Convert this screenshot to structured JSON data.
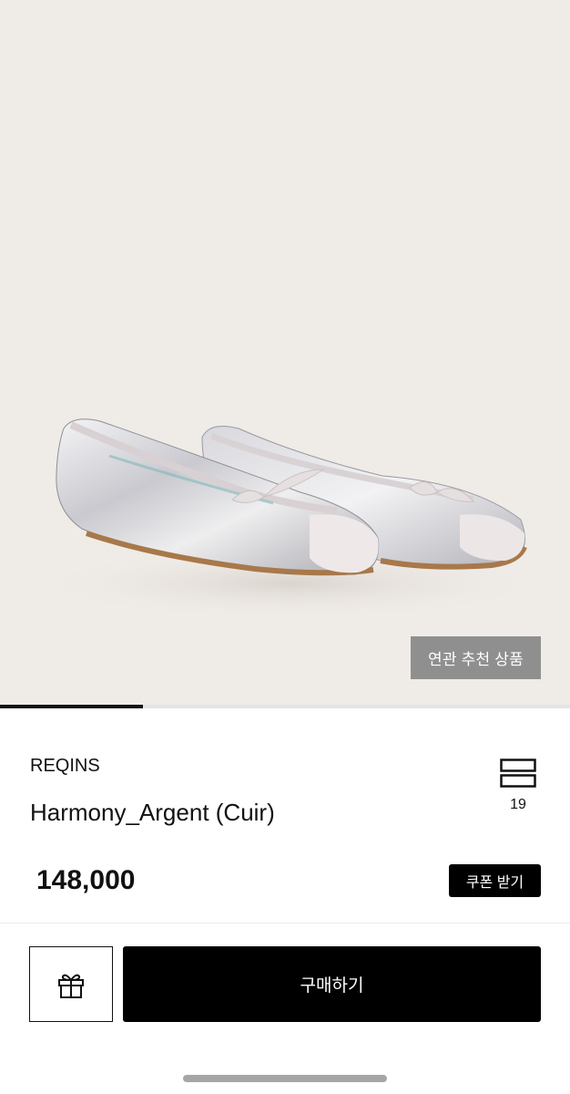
{
  "hero": {
    "image_alt": "silver leather ballet flats with pale pink toe caps and bows",
    "related_button_label": "연관 추천 상품",
    "carousel_progress": 0.25
  },
  "product": {
    "brand": "REQINS",
    "name": "Harmony_Argent (Cuir)",
    "price": "148,000",
    "like_count": "19",
    "like_icon": "stacked-bars-icon"
  },
  "actions": {
    "coupon_label": "쿠폰 받기",
    "gift_icon": "gift-icon",
    "buy_label": "구매하기"
  },
  "colors": {
    "background": "#efebe7",
    "accent": "#000000",
    "overlay_button": "#8f8f8f"
  }
}
